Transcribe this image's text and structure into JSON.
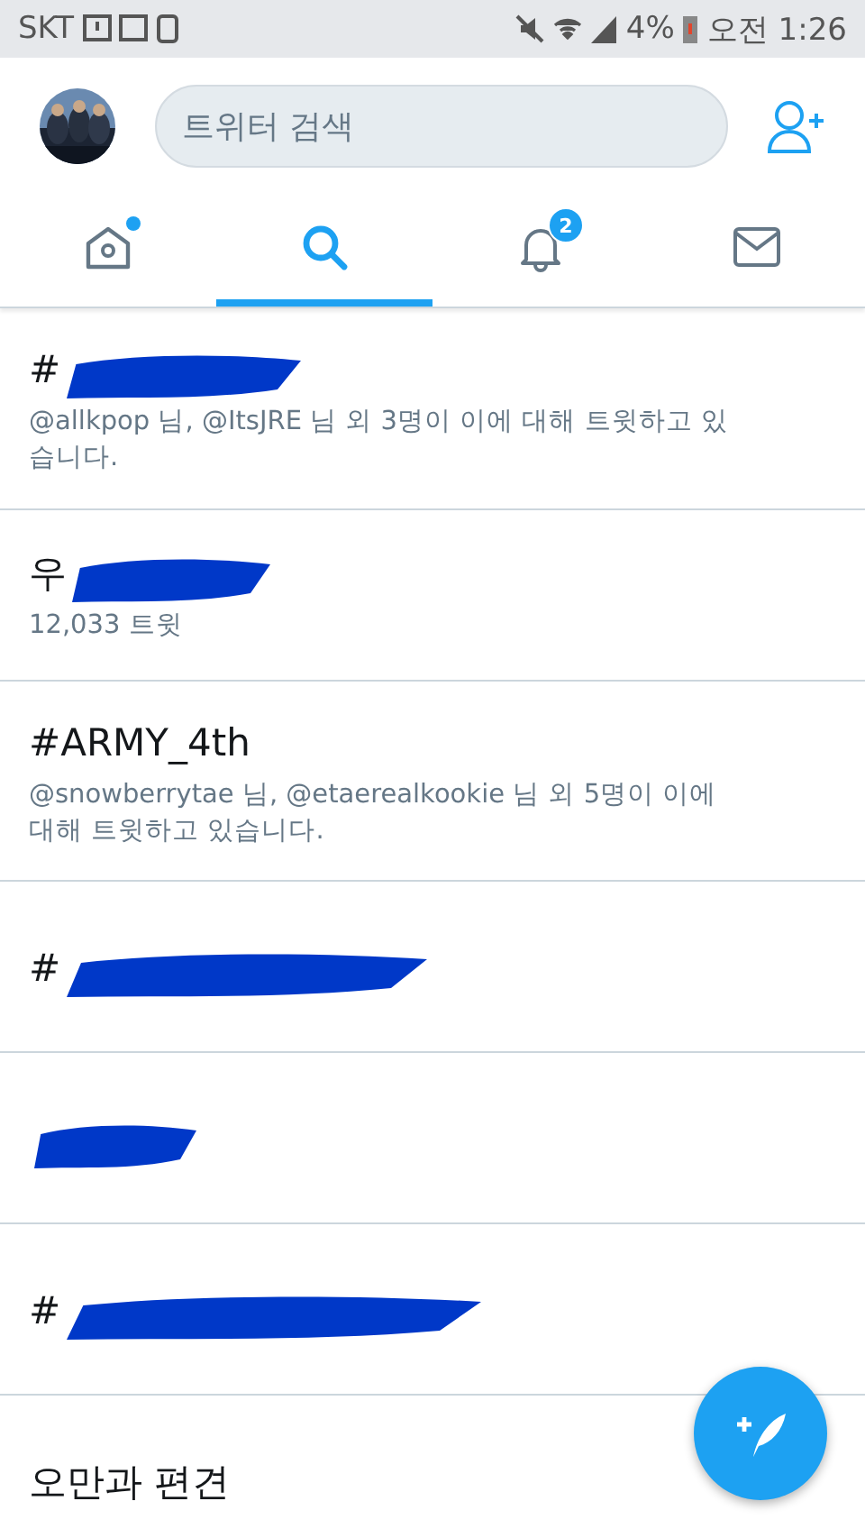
{
  "status_bar": {
    "carrier": "SKT",
    "battery": "4%",
    "time": "오전 1:26"
  },
  "header": {
    "search": {
      "placeholder": "트위터 검색"
    }
  },
  "tabs": [
    {
      "kind": "home",
      "selected": false,
      "dot": true
    },
    {
      "kind": "search",
      "selected": true
    },
    {
      "kind": "notifications",
      "selected": false,
      "badge": "2"
    },
    {
      "kind": "messages",
      "selected": false
    }
  ],
  "trends": [
    {
      "title": "#",
      "redacted": true,
      "subtitle": "@allkpop 님, @ItsJRE 님 외 3명이 이에 대해 트윗하고 있습니다."
    },
    {
      "title": "우",
      "redacted": true,
      "subtitle": "12,033 트윗"
    },
    {
      "title": "#ARMY_4th",
      "redacted": false,
      "subtitle": "@snowberrytae 님, @etaerealkookie 님 외 5명이 이에 대해 트윗하고 있습니다."
    },
    {
      "title": "#",
      "redacted": true
    },
    {
      "redacted": true
    },
    {
      "title": "#",
      "redacted": true
    },
    {
      "title": "오만과 편견",
      "redacted": false
    }
  ],
  "compose_button": {
    "kind": "compose"
  }
}
